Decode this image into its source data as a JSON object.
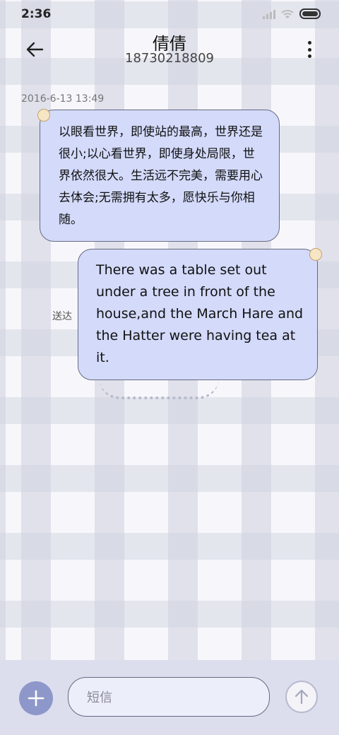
{
  "status_bar": {
    "time": "2:36",
    "icons": [
      "signal-icon",
      "wifi-icon",
      "battery-icon"
    ]
  },
  "header": {
    "contact_name": "倩倩",
    "phone_number": "18730218809",
    "back_icon": "arrow-left-icon",
    "menu_icon": "more-vertical-icon"
  },
  "messages": [
    {
      "direction": "incoming",
      "timestamp": "2016-6-13 13:49",
      "text": "以眼看世界，即使站的最高，世界还是很小;以心看世界，即使身处局限，世界依然很大。生活远不完美，需要用心去体会;无需拥有太多，愿快乐与你相随。"
    },
    {
      "direction": "outgoing",
      "status": "送达",
      "text": "There was a table set out under a tree in front of the house,and the March Hare and the Hatter were having tea at it."
    }
  ],
  "composer": {
    "placeholder": "短信",
    "value": "",
    "add_icon": "plus-icon",
    "send_icon": "arrow-up-icon"
  },
  "colors": {
    "bubble": "#d3dafa",
    "bubble_border": "#666a80",
    "bottom_bar": "#dcdeee",
    "add_button": "#8e97c9"
  }
}
